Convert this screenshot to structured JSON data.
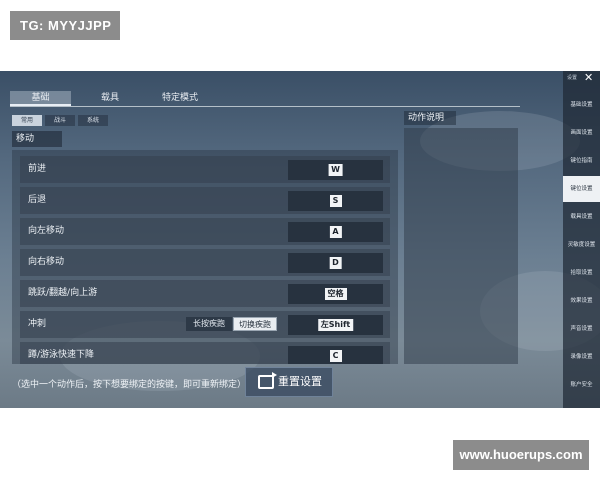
{
  "watermarks": {
    "top_left": "TG: MYYJJPP",
    "bottom_right": "www.huoerups.com"
  },
  "tabs": [
    {
      "label": "基础",
      "active": true
    },
    {
      "label": "载具",
      "active": false
    },
    {
      "label": "特定模式",
      "active": false
    }
  ],
  "subtabs": [
    {
      "label": "常用",
      "active": true
    },
    {
      "label": "战斗",
      "active": false
    },
    {
      "label": "系统",
      "active": false
    }
  ],
  "section_title": "移动",
  "rows": [
    {
      "label": "前进",
      "key": "W"
    },
    {
      "label": "后退",
      "key": "S"
    },
    {
      "label": "向左移动",
      "key": "A"
    },
    {
      "label": "向右移动",
      "key": "D"
    },
    {
      "label": "跳跃/翻越/向上游",
      "key": "空格"
    },
    {
      "label": "冲刺",
      "key": "左Shift",
      "toggle": {
        "off_label": "长按疾跑",
        "on_label": "切换疾跑"
      }
    },
    {
      "label": "蹲/游泳快速下降",
      "key": "C"
    }
  ],
  "description": {
    "title": "动作说明"
  },
  "hint": "（选中一个动作后，按下想要绑定的按键，即可重新绑定）",
  "reset_button": "重置设置",
  "sidebar": {
    "top_label": "设置",
    "items": [
      {
        "label": "基础设置",
        "active": false
      },
      {
        "label": "画面设置",
        "active": false
      },
      {
        "label": "键位指南",
        "active": false
      },
      {
        "label": "键位设置",
        "active": true
      },
      {
        "label": "载具设置",
        "active": false
      },
      {
        "label": "灵敏度设置",
        "active": false
      },
      {
        "label": "拾取设置",
        "active": false
      },
      {
        "label": "效果设置",
        "active": false
      },
      {
        "label": "声音设置",
        "active": false
      },
      {
        "label": "录像设置",
        "active": false
      },
      {
        "label": "账户安全",
        "active": false
      }
    ]
  },
  "colors": {
    "sidebar_active_bg": "#eef1f4",
    "keybox_bg": "#27323f",
    "keycap_bg": "#f2f4f6"
  }
}
